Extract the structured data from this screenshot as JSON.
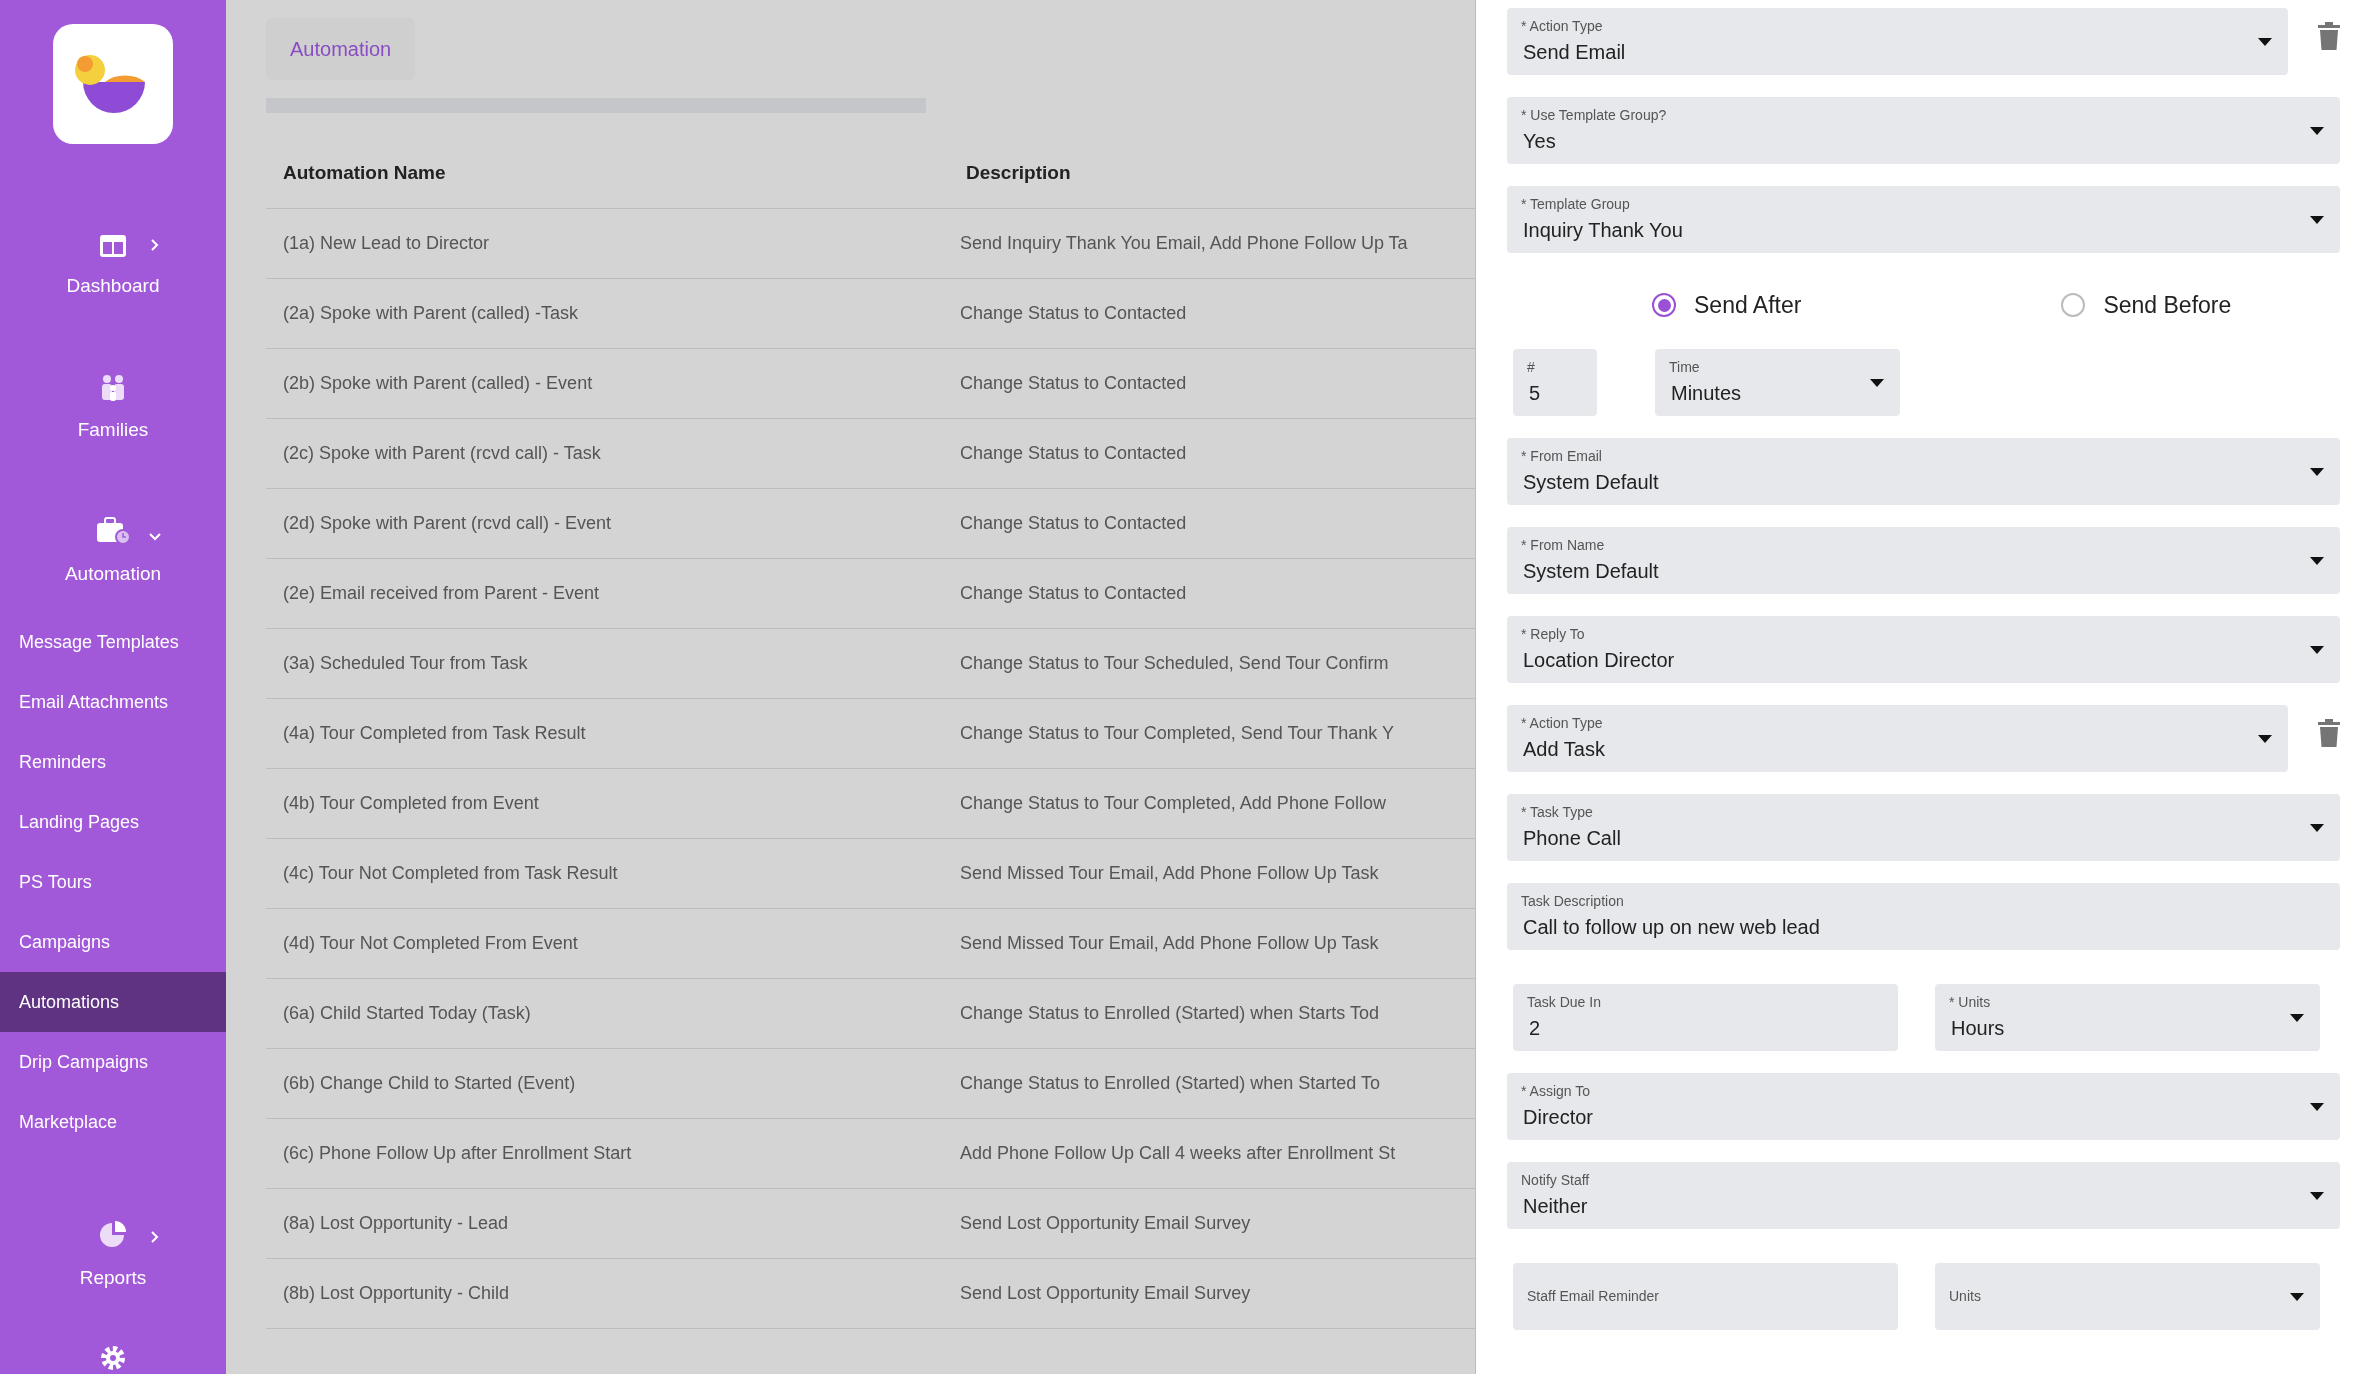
{
  "sidebar": {
    "items": [
      {
        "kind": "main",
        "label": "Dashboard",
        "expandable": true,
        "expanded": false
      },
      {
        "kind": "main",
        "label": "Families",
        "expandable": false,
        "expanded": false
      },
      {
        "kind": "main",
        "label": "Automation",
        "expandable": true,
        "expanded": true
      },
      {
        "kind": "sub",
        "label": "Message Templates",
        "selected": false
      },
      {
        "kind": "sub",
        "label": "Email Attachments",
        "selected": false
      },
      {
        "kind": "sub",
        "label": "Reminders",
        "selected": false
      },
      {
        "kind": "sub",
        "label": "Landing Pages",
        "selected": false
      },
      {
        "kind": "sub",
        "label": "PS Tours",
        "selected": false
      },
      {
        "kind": "sub",
        "label": "Campaigns",
        "selected": false
      },
      {
        "kind": "sub",
        "label": "Automations",
        "selected": true
      },
      {
        "kind": "sub",
        "label": "Drip Campaigns",
        "selected": false
      },
      {
        "kind": "sub",
        "label": "Marketplace",
        "selected": false
      },
      {
        "kind": "main",
        "label": "Reports",
        "expandable": true,
        "expanded": false
      }
    ]
  },
  "breadcrumb": "Automation",
  "table": {
    "columns": [
      "Automation Name",
      "Description"
    ],
    "rows": [
      {
        "name": "(1a) New Lead to Director",
        "description": "Send Inquiry Thank You Email, Add Phone Follow Up Ta"
      },
      {
        "name": "(2a) Spoke with Parent (called) -Task",
        "description": "Change Status to Contacted"
      },
      {
        "name": "(2b) Spoke with Parent (called) - Event",
        "description": "Change Status to Contacted"
      },
      {
        "name": "(2c) Spoke with Parent (rcvd call) - Task",
        "description": "Change Status to Contacted"
      },
      {
        "name": "(2d) Spoke with Parent (rcvd call) - Event",
        "description": "Change Status to Contacted"
      },
      {
        "name": "(2e) Email received from Parent - Event",
        "description": "Change Status to Contacted"
      },
      {
        "name": "(3a) Scheduled Tour from Task",
        "description": "Change Status to Tour Scheduled, Send Tour Confirm"
      },
      {
        "name": "(4a) Tour Completed from Task Result",
        "description": "Change Status to Tour Completed, Send Tour Thank Y"
      },
      {
        "name": "(4b) Tour Completed from Event",
        "description": "Change Status to Tour Completed, Add Phone Follow"
      },
      {
        "name": "(4c) Tour Not Completed from Task Result",
        "description": "Send Missed Tour Email, Add Phone Follow Up Task"
      },
      {
        "name": "(4d) Tour Not Completed From Event",
        "description": "Send Missed Tour Email, Add Phone Follow Up Task"
      },
      {
        "name": "(6a) Child Started Today (Task)",
        "description": "Change Status to Enrolled (Started) when Starts Tod"
      },
      {
        "name": "(6b) Change Child to Started (Event)",
        "description": "Change Status to Enrolled (Started) when Started To"
      },
      {
        "name": "(6c) Phone Follow Up after Enrollment Start",
        "description": "Add Phone Follow Up Call 4 weeks after Enrollment St"
      },
      {
        "name": "(8a) Lost Opportunity - Lead",
        "description": "Send Lost Opportunity Email Survey"
      },
      {
        "name": "(8b) Lost Opportunity - Child",
        "description": "Send Lost Opportunity Email Survey"
      }
    ]
  },
  "panel": {
    "items": [
      {
        "kind": "select",
        "label": "* Action Type",
        "value": "Send Email",
        "deletable": true
      },
      {
        "kind": "select",
        "label": "* Use Template Group?",
        "value": "Yes",
        "deletable": false
      },
      {
        "kind": "select",
        "label": "* Template Group",
        "value": "Inquiry Thank You",
        "deletable": false
      },
      {
        "kind": "radios",
        "options": [
          {
            "label": "Send After",
            "selected": true
          },
          {
            "label": "Send Before",
            "selected": false
          }
        ]
      },
      {
        "kind": "compact_pair",
        "fields": [
          {
            "kind": "text",
            "label": "#",
            "value": "5"
          },
          {
            "kind": "select",
            "label": "Time",
            "value": "Minutes"
          }
        ]
      },
      {
        "kind": "select",
        "label": "* From Email",
        "value": "System Default",
        "deletable": false
      },
      {
        "kind": "select",
        "label": "* From Name",
        "value": "System Default",
        "deletable": false
      },
      {
        "kind": "select",
        "label": "* Reply To",
        "value": "Location Director",
        "deletable": false
      },
      {
        "kind": "select",
        "label": "* Action Type",
        "value": "Add Task",
        "deletable": true
      },
      {
        "kind": "select",
        "label": "* Task Type",
        "value": "Phone Call",
        "deletable": false
      },
      {
        "kind": "text",
        "label": "Task Description",
        "value": "Call to follow up on new web lead"
      },
      {
        "kind": "pair",
        "fields": [
          {
            "kind": "text",
            "label": "Task Due In",
            "value": "2"
          },
          {
            "kind": "select",
            "label": "* Units",
            "value": "Hours"
          }
        ]
      },
      {
        "kind": "select",
        "label": "* Assign To",
        "value": "Director",
        "deletable": false
      },
      {
        "kind": "select",
        "label": "Notify Staff",
        "value": "Neither",
        "deletable": false
      },
      {
        "kind": "pair",
        "fields": [
          {
            "kind": "text",
            "label": "Staff Email Reminder"
          },
          {
            "kind": "select",
            "label": "Units"
          }
        ]
      }
    ]
  }
}
